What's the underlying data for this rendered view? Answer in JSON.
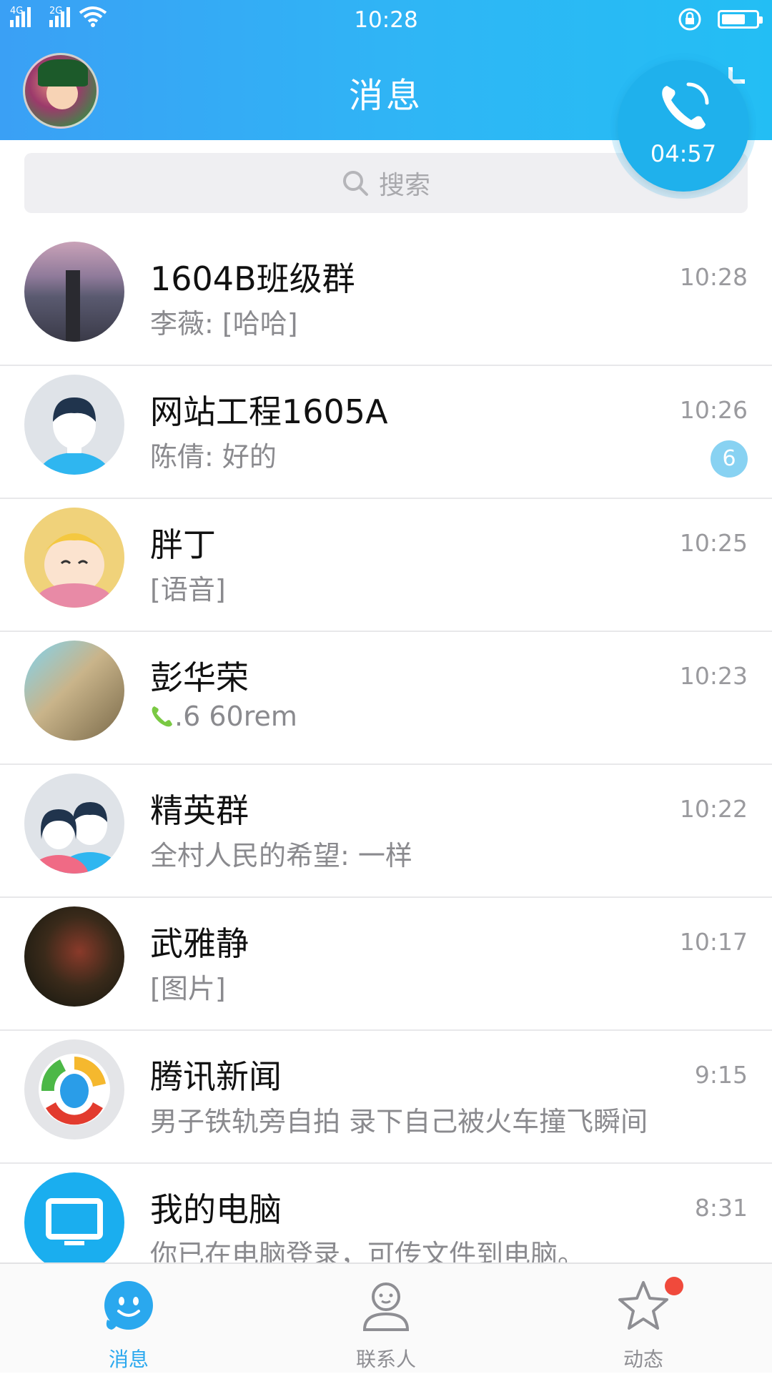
{
  "status_bar": {
    "network_1": "4G",
    "network_2": "2G",
    "time": "10:28"
  },
  "header": {
    "title": "消息"
  },
  "call": {
    "timer": "04:57"
  },
  "search": {
    "placeholder": "搜索"
  },
  "conversations": [
    {
      "name": "1604B班级群",
      "preview": "李薇: [哈哈]",
      "time": "10:28",
      "badge": ""
    },
    {
      "name": "网站工程1605A",
      "preview": "陈倩: 好的",
      "time": "10:26",
      "badge": "6"
    },
    {
      "name": "胖丁",
      "preview": "[语音]",
      "time": "10:25",
      "badge": ""
    },
    {
      "name": "彭华荣",
      "preview": ".6 60rem",
      "time": "10:23",
      "badge": ""
    },
    {
      "name": "精英群",
      "preview": "全村人民的希望: 一样",
      "time": "10:22",
      "badge": ""
    },
    {
      "name": "武雅静",
      "preview": "[图片]",
      "time": "10:17",
      "badge": ""
    },
    {
      "name": "腾讯新闻",
      "preview": "男子铁轨旁自拍 录下自己被火车撞飞瞬间",
      "time": "9:15",
      "badge": ""
    },
    {
      "name": "我的电脑",
      "preview": "你已在电脑登录，可传文件到电脑。",
      "time": "8:31",
      "badge": ""
    }
  ],
  "tabs": [
    {
      "label": "消息"
    },
    {
      "label": "联系人"
    },
    {
      "label": "动态"
    }
  ],
  "colors": {
    "header": "#2fb6f5",
    "accent": "#2aa8ee",
    "badge": "#88d2f2",
    "notification_dot": "#f04a3c"
  }
}
